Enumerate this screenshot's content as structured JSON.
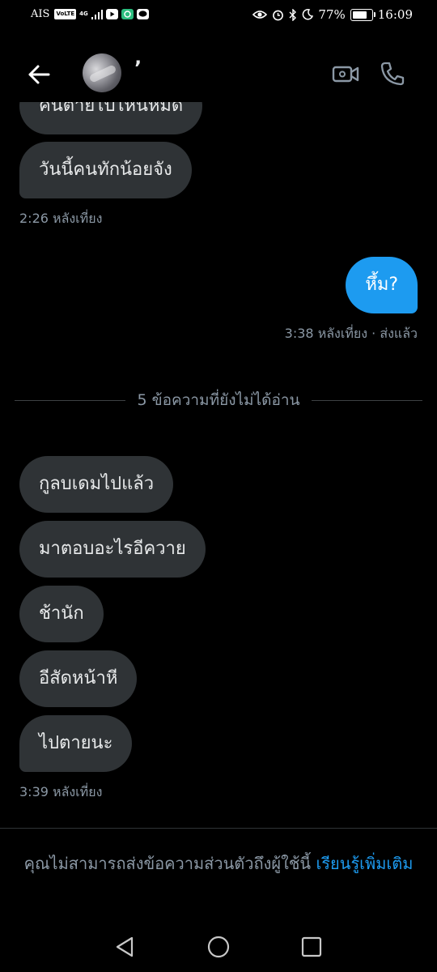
{
  "status_bar": {
    "carrier": "AIS",
    "volte": "VoLTE",
    "network": "4G",
    "battery": "77%",
    "battery_level": 0.77,
    "time": "16:09"
  },
  "header": {
    "contact_name": "’",
    "icons": [
      "back-arrow-icon",
      "video-camera-icon",
      "phone-icon"
    ]
  },
  "messages": [
    {
      "direction": "in",
      "text": "คนตายไปไหนหมด"
    },
    {
      "direction": "in",
      "text": "วันนี้คนทักน้อยจัง"
    },
    {
      "meta": "2:26 หลังเที่ยง"
    },
    {
      "direction": "out",
      "text": "หึ้ม?"
    },
    {
      "meta": "3:38 หลังเที่ยง · ส่งแล้ว"
    },
    {
      "divider": "5 ข้อความที่ยังไม่ได้อ่าน"
    },
    {
      "direction": "in",
      "text": "กูลบเดมไปแล้ว"
    },
    {
      "direction": "in",
      "text": "มาตอบอะไรอีควาย"
    },
    {
      "direction": "in",
      "text": "ช้านัก"
    },
    {
      "direction": "in",
      "text": "อีสัดหน้าหี"
    },
    {
      "direction": "in",
      "text": "ไปตายนะ"
    },
    {
      "meta": "3:39 หลังเที่ยง"
    }
  ],
  "footer": {
    "notice": "คุณไม่สามารถส่งข้อความส่วนตัวถึงผู้ใช้นี้",
    "link": "เรียนรู้เพิ่มเติม"
  },
  "colors": {
    "background": "#000000",
    "incoming_bubble": "#2f3336",
    "outgoing_bubble": "#1d9bf0",
    "muted_text": "#8b98a5",
    "link": "#1d9bf0"
  },
  "nav": [
    "back-triangle-icon",
    "home-circle-icon",
    "recents-square-icon"
  ]
}
